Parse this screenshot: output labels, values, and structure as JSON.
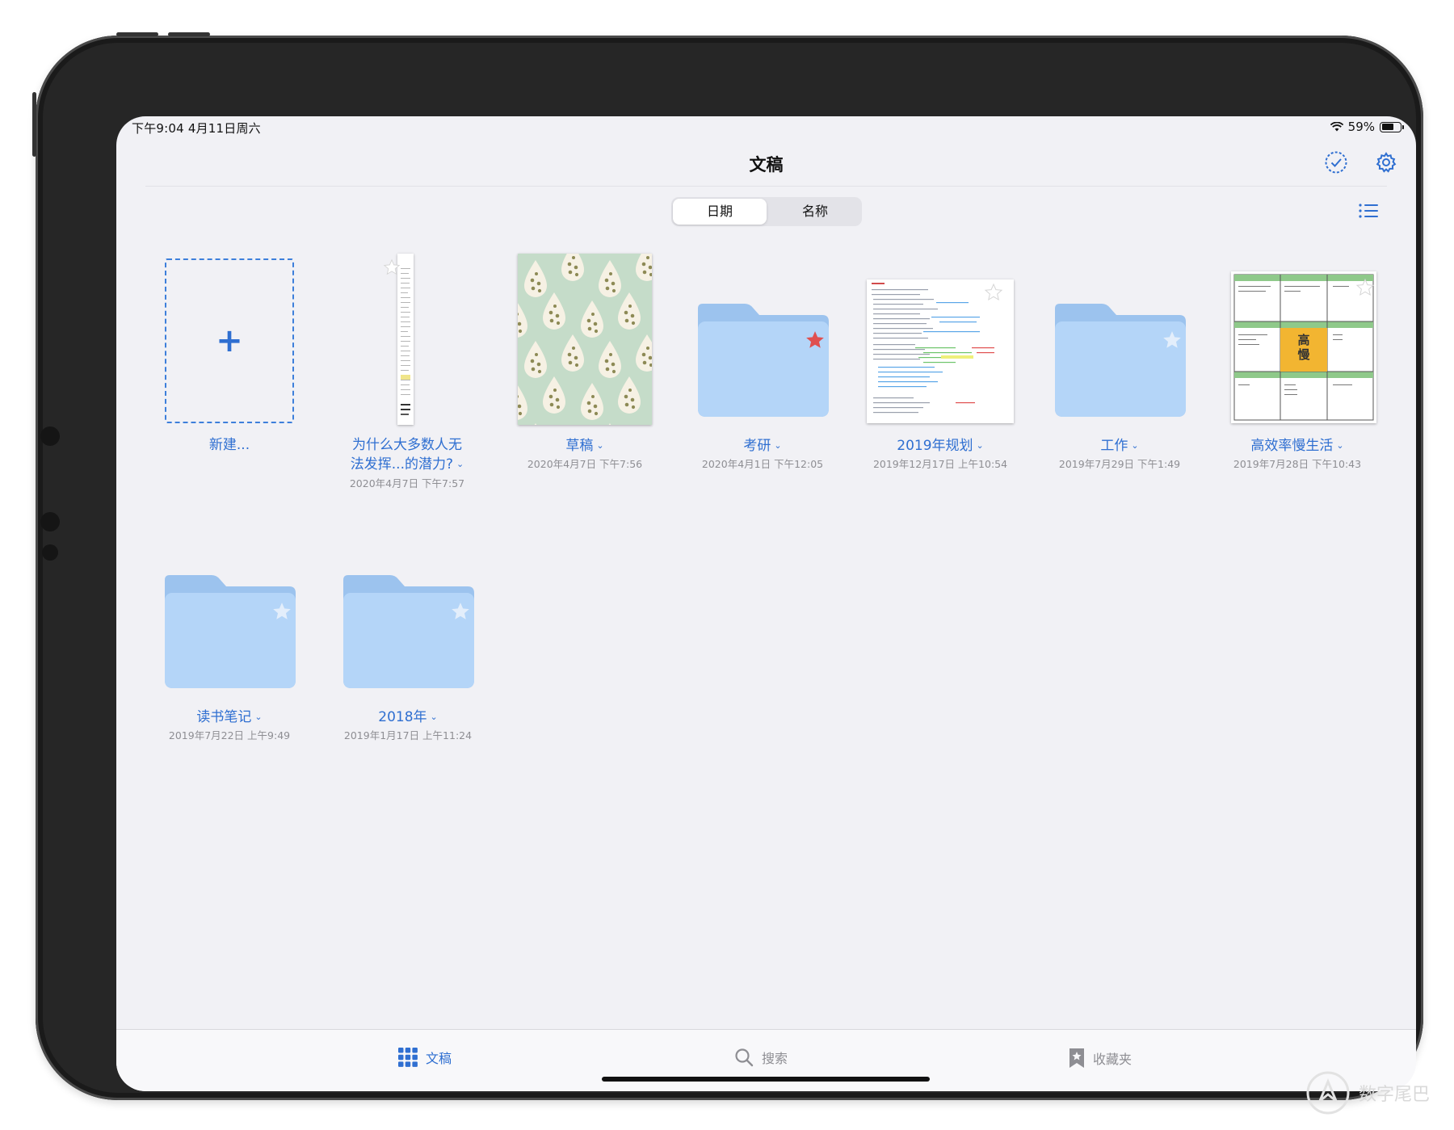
{
  "status_bar": {
    "time_date": "下午9:04  4月11日周六",
    "battery": "59%",
    "battery_level": 0.59
  },
  "nav": {
    "title": "文稿"
  },
  "sort": {
    "options": [
      "日期",
      "名称"
    ],
    "selected": "日期"
  },
  "items": [
    {
      "name": "新建...",
      "date": "",
      "kind": "new"
    },
    {
      "name": "为什么大多数人无法发挥...的潜力?",
      "name_line1": "为什么大多数人无",
      "name_line2": "法发挥...的潜力?",
      "date": "2020年4月7日 下午7:57",
      "kind": "document-tall",
      "starred": false
    },
    {
      "name": "草稿",
      "date": "2020年4月7日 下午7:56",
      "kind": "notebook-pattern",
      "starred": false
    },
    {
      "name": "考研",
      "date": "2020年4月1日 下午12:05",
      "kind": "folder",
      "starred": true
    },
    {
      "name": "2019年规划",
      "date": "2019年12月17日 上午10:54",
      "kind": "document-notes",
      "starred": false
    },
    {
      "name": "工作",
      "date": "2019年7月29日 下午1:49",
      "kind": "folder",
      "starred": false
    },
    {
      "name": "高效率慢生活",
      "date": "2019年7月28日 下午10:43",
      "kind": "document-grid",
      "starred": false
    },
    {
      "name": "读书笔记",
      "date": "2019年7月22日 上午9:49",
      "kind": "folder",
      "starred": false
    },
    {
      "name": "2018年",
      "date": "2019年1月17日 上午11:24",
      "kind": "folder",
      "starred": false
    }
  ],
  "grid_doc": {
    "center_text_1": "高",
    "center_text_2": "慢"
  },
  "tabbar": {
    "tabs": [
      {
        "label": "文稿",
        "icon": "grid-icon",
        "active": true
      },
      {
        "label": "搜索",
        "icon": "search-icon",
        "active": false
      },
      {
        "label": "收藏夹",
        "icon": "bookmark-icon",
        "active": false
      }
    ]
  },
  "watermark": {
    "text": "数字尾巴"
  },
  "colors": {
    "accent": "#2f6fd1",
    "folder_front": "#b4d5f8",
    "folder_back": "#9cc3ee",
    "star_favorite": "#e05050",
    "star_empty": "#e3eefb",
    "grid_highlight": "#f2b531"
  }
}
